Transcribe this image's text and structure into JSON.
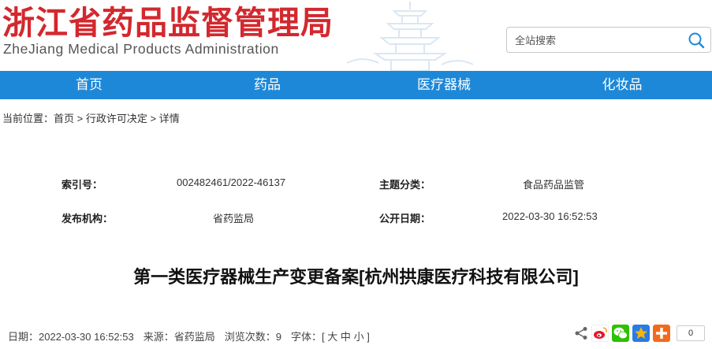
{
  "site": {
    "title_cn": "浙江省药品监督管理局",
    "title_en": "ZheJiang Medical Products Administration"
  },
  "search": {
    "placeholder": "全站搜索",
    "icon": "search-icon"
  },
  "nav": {
    "items": [
      {
        "label": "首页"
      },
      {
        "label": "药品"
      },
      {
        "label": "医疗器械"
      },
      {
        "label": "化妆品"
      }
    ]
  },
  "breadcrumb": {
    "prefix": "当前位置：",
    "home": "首页",
    "sep": " > ",
    "section": "行政许可决定",
    "current": "详情"
  },
  "meta": {
    "index_label": "索引号：",
    "index_value": "002482461/2022-46137",
    "topic_label": "主题分类：",
    "topic_value": "食品药品监管",
    "publisher_label": "发布机构：",
    "publisher_value": "省药监局",
    "date_label": "公开日期：",
    "date_value": "2022-03-30 16:52:53"
  },
  "article": {
    "title": "第一类医疗器械生产变更备案[杭州拱康医疗科技有限公司]"
  },
  "info": {
    "date_label": "日期：",
    "date_value": "2022-03-30 16:52:53",
    "source_label": "来源：",
    "source_value": "省药监局",
    "views_label": "浏览次数：",
    "views_value": "9",
    "font_label": "字体：",
    "font_open": "[",
    "font_large": "大",
    "font_medium": "中",
    "font_small": "小",
    "font_close": "]"
  },
  "share": {
    "count": "0",
    "icons": [
      "share-icon",
      "weibo-icon",
      "wechat-icon",
      "qzone-icon",
      "more-plus-icon"
    ],
    "colors": {
      "weibo": "#e6162d",
      "wechat": "#2dc100",
      "qzone": "#f5b50a",
      "plus": "#f26a1b"
    }
  },
  "colors": {
    "brand_red": "#d3282e",
    "nav_blue": "#1e88d8"
  }
}
